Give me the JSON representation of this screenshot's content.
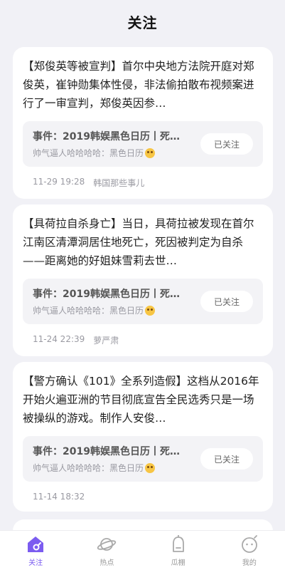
{
  "header": {
    "title": "关注"
  },
  "feed": [
    {
      "text": "【郑俊英等被宣判】首尔中央地方法院开庭对郑俊英，崔钟勋集体性侵，非法偷拍散布视频案进行了一审宣判，郑俊英因参…",
      "event_title": "事件：2019韩娱黑色日历丨死…",
      "event_sub": "帅气逼人哈哈哈哈：黑色日历",
      "follow_label": "已关注",
      "time": "11-29 19:28",
      "source": "韩国那些事儿"
    },
    {
      "text": "【具荷拉自杀身亡】当日，具荷拉被发现在首尔江南区清潭洞居住地死亡，死因被判定为自杀——距离她的好姐妹雪莉去世…",
      "event_title": "事件：2019韩娱黑色日历丨死…",
      "event_sub": "帅气逼人哈哈哈哈：黑色日历",
      "follow_label": "已关注",
      "time": "11-24 22:39",
      "source": "萝严肃"
    },
    {
      "text": "【警方确认《101》全系列造假】这档从2016年开始火遍亚洲的节目彻底宣告全民选秀只是一场被操纵的游戏。制作人安俊…",
      "event_title": "事件：2019韩娱黑色日历丨死…",
      "event_sub": "帅气逼人哈哈哈哈：黑色日历",
      "follow_label": "已关注",
      "time": "11-14 18:32",
      "source": ""
    }
  ],
  "tabs": [
    {
      "label": "关注",
      "icon": "home-follow-icon",
      "active": true
    },
    {
      "label": "热点",
      "icon": "planet-icon",
      "active": false
    },
    {
      "label": "瓜棚",
      "icon": "bell-tent-icon",
      "active": false
    },
    {
      "label": "我的",
      "icon": "face-profile-icon",
      "active": false
    }
  ],
  "colors": {
    "accent": "#7b5cf0",
    "background": "#f1f1f6"
  }
}
